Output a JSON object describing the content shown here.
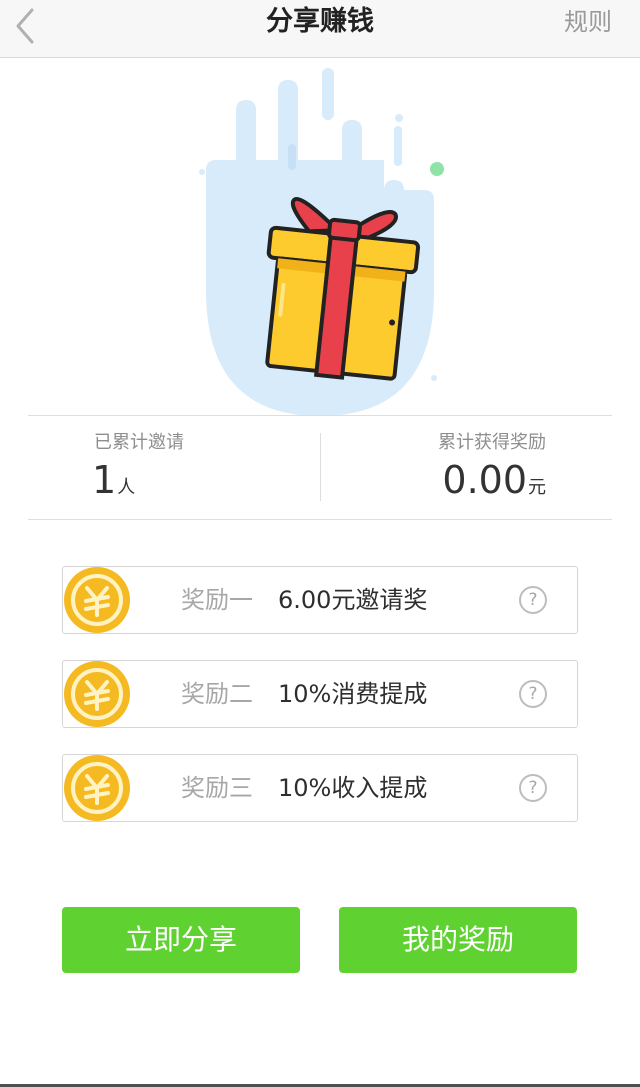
{
  "nav": {
    "title": "分享赚钱",
    "rules_label": "规则",
    "back_icon": "chevron-left-icon"
  },
  "colors": {
    "accent_green": "#5fd232",
    "gift_yellow": "#fdcb2e",
    "ribbon_red": "#e8414b",
    "hero_blue": "#d8ebfa",
    "coin_gold": "#f5b921"
  },
  "stats": {
    "invited_label": "已累计邀请",
    "invited_value": "1",
    "invited_unit": "人",
    "reward_label": "累计获得奖励",
    "reward_value": "0.00",
    "reward_unit": "元"
  },
  "rewards": [
    {
      "label": "奖励一",
      "desc": "6.00元邀请奖",
      "icon": "coin-icon",
      "help": "?"
    },
    {
      "label": "奖励二",
      "desc": "10%消费提成",
      "icon": "coin-icon",
      "help": "?"
    },
    {
      "label": "奖励三",
      "desc": "10%收入提成",
      "icon": "coin-icon",
      "help": "?"
    }
  ],
  "actions": {
    "share_now": "立即分享",
    "my_rewards": "我的奖励"
  }
}
